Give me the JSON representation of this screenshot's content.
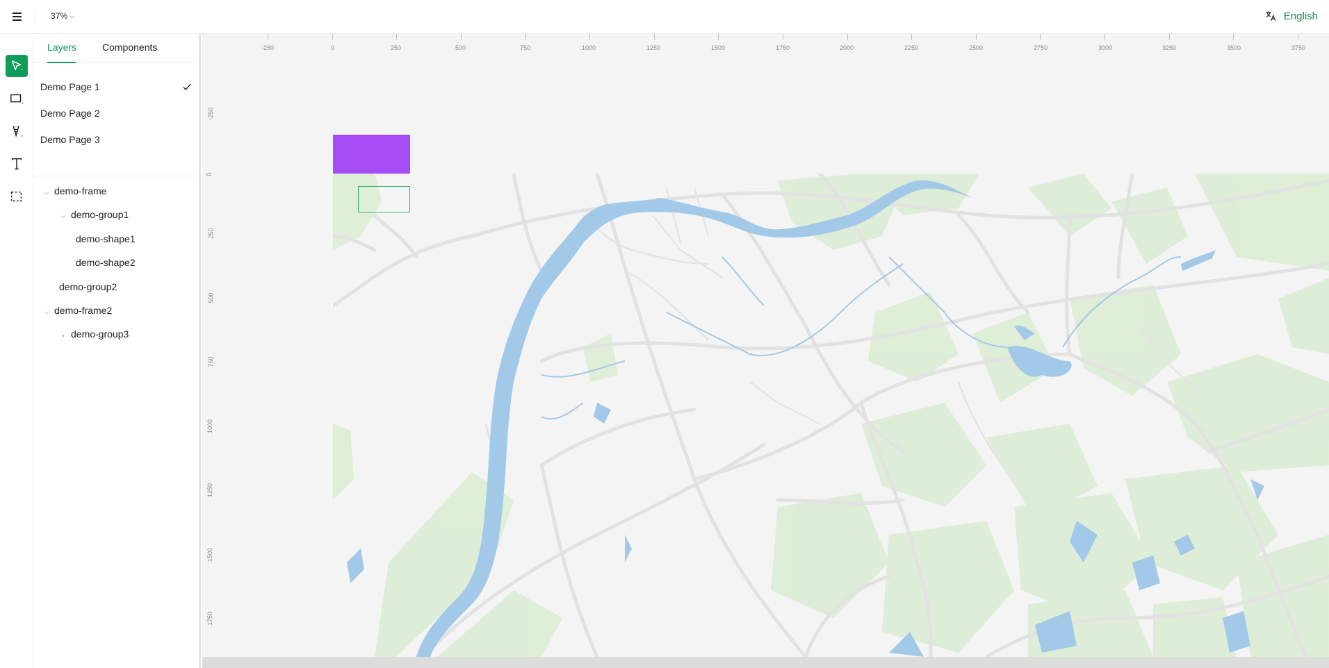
{
  "topbar": {
    "menu_icon": "hamburger-menu-icon",
    "zoom_label": "37%",
    "language_icon": "translate-icon",
    "language_label": "English"
  },
  "colors": {
    "accent": "#0f9d58",
    "shape_fill": "#a64cf4",
    "water": "#a3c9e8",
    "vegetation": "#dcedd4",
    "road": "#e2e2e2",
    "canvas_bg": "#f4f4f4"
  },
  "tools": [
    {
      "name": "select-tool",
      "icon": "cursor-arrow-icon",
      "active": true
    },
    {
      "name": "rectangle-tool",
      "icon": "rectangle-icon",
      "active": false
    },
    {
      "name": "pen-tool",
      "icon": "pen-nib-icon",
      "active": false
    },
    {
      "name": "text-tool",
      "icon": "text-t-icon",
      "active": false
    },
    {
      "name": "frame-select-tool",
      "icon": "dashed-selection-icon",
      "active": false
    }
  ],
  "panel": {
    "tabs": [
      {
        "label": "Layers",
        "active": true
      },
      {
        "label": "Components",
        "active": false
      }
    ],
    "pages": [
      {
        "label": "Demo Page 1",
        "selected": true
      },
      {
        "label": "Demo Page 2",
        "selected": false
      },
      {
        "label": "Demo Page 3",
        "selected": false
      }
    ],
    "layers": [
      {
        "label": "demo-frame",
        "level": 0,
        "caret": "expanded"
      },
      {
        "label": "demo-group1",
        "level": 1,
        "caret": "expanded"
      },
      {
        "label": "demo-shape1",
        "level": 2,
        "caret": "none"
      },
      {
        "label": "demo-shape2",
        "level": 2,
        "caret": "none"
      },
      {
        "label": "demo-group2",
        "level": 1,
        "caret": "none"
      },
      {
        "label": "demo-frame2",
        "level": 0,
        "caret": "expanded"
      },
      {
        "label": "demo-group3",
        "level": 1,
        "caret": "collapsed"
      }
    ]
  },
  "rulers": {
    "top": [
      "-250",
      "0",
      "250",
      "500",
      "750",
      "1000",
      "1250",
      "1500",
      "1750",
      "2000",
      "2250",
      "2500",
      "2750",
      "3000",
      "3250",
      "3500",
      "3750"
    ],
    "left": [
      "-250",
      "0",
      "250",
      "500",
      "750",
      "1000",
      "1250",
      "1500",
      "1750"
    ]
  }
}
